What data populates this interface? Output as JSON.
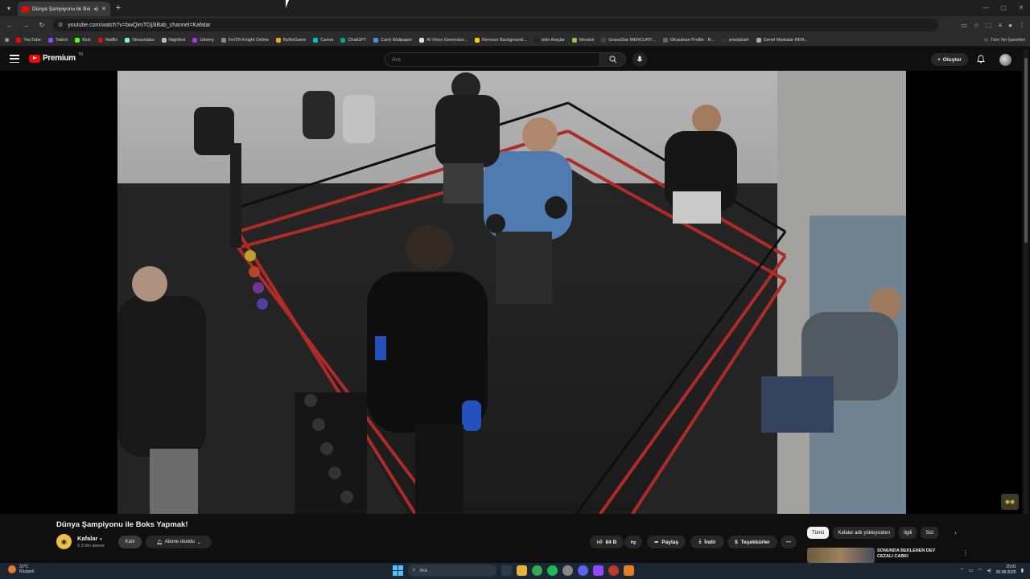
{
  "browser": {
    "tab_title": "Dünya Şampiyonu ile Boks Yapmak!",
    "url": "youtube.com/watch?v=bwQimTOj3iBab_channel=Kafalar",
    "bookmarks": [
      {
        "label": "YouTube",
        "color": "#ff0000"
      },
      {
        "label": "Twitch",
        "color": "#9146ff"
      },
      {
        "label": "Kick",
        "color": "#53fc18"
      },
      {
        "label": "Netflix",
        "color": "#e50914"
      },
      {
        "label": "Streamlabs",
        "color": "#80f5d2"
      },
      {
        "label": "Nightbot",
        "color": "#bbbbbb"
      },
      {
        "label": "Udemy",
        "color": "#a435f0"
      },
      {
        "label": "FmTR-Knight Online",
        "color": "#888888"
      },
      {
        "label": "ByNoGame",
        "color": "#f5a623"
      },
      {
        "label": "Canva",
        "color": "#00c4cc"
      },
      {
        "label": "ChatGPT",
        "color": "#10a37f"
      },
      {
        "label": "Canlı Wallpaper",
        "color": "#4a90e2"
      },
      {
        "label": "AI Voice Generator...",
        "color": "#dddddd"
      },
      {
        "label": "Remove Background...",
        "color": "#ffcc00"
      },
      {
        "label": "tetio Araçlar",
        "color": "#222222"
      },
      {
        "label": "Moobot",
        "color": "#8ec63f"
      },
      {
        "label": "GravaStar MERCURY...",
        "color": "#444444"
      },
      {
        "label": "GKarahan Profile - R...",
        "color": "#666666"
      },
      {
        "label": "pixelplush",
        "color": "#333333"
      },
      {
        "label": "Genel Markalar REN...",
        "color": "#aaaaaa"
      }
    ],
    "bookmarks_right": "Tüm Yer İşaretleri"
  },
  "youtube": {
    "brand": "Premium",
    "country": "TR",
    "search_placeholder": "Ara",
    "create_label": "Oluştur"
  },
  "video": {
    "title": "Dünya Şampiyonu ile Boks Yapmak!",
    "channel_name": "Kafalar",
    "subscribers": "9,3 Mn abone",
    "join_label": "Katıl",
    "subscribed_label": "Abone olundu",
    "likes": "84 B",
    "share_label": "Paylaş",
    "download_label": "İndir",
    "thanks_label": "Teşekkürler"
  },
  "chips": [
    "Tümü",
    "Kafalar adlı yükleyiciden",
    "İlgili",
    "Sizi"
  ],
  "recommendation": {
    "title": "SONUNDA BEKLENEN DEV CEZALI CABKI"
  },
  "taskbar": {
    "temperature": "31°C",
    "weather_desc": "Rüzgarlı",
    "search_placeholder": "Ara",
    "time": "15:01",
    "date": "20.08.2025"
  }
}
